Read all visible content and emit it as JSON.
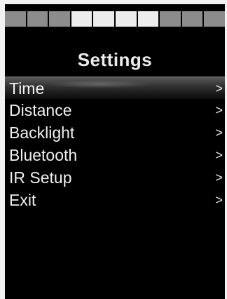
{
  "screen": {
    "title": "Settings",
    "status_segments": [
      false,
      false,
      false,
      true,
      true,
      true,
      true,
      false,
      false,
      false
    ]
  },
  "menu": {
    "selected_index": 0,
    "items": [
      {
        "label": "Time",
        "chevron": ">"
      },
      {
        "label": "Distance",
        "chevron": ">"
      },
      {
        "label": "Backlight",
        "chevron": ">"
      },
      {
        "label": "Bluetooth",
        "chevron": ">"
      },
      {
        "label": "IR Setup",
        "chevron": ">"
      },
      {
        "label": "Exit",
        "chevron": ">"
      }
    ]
  }
}
